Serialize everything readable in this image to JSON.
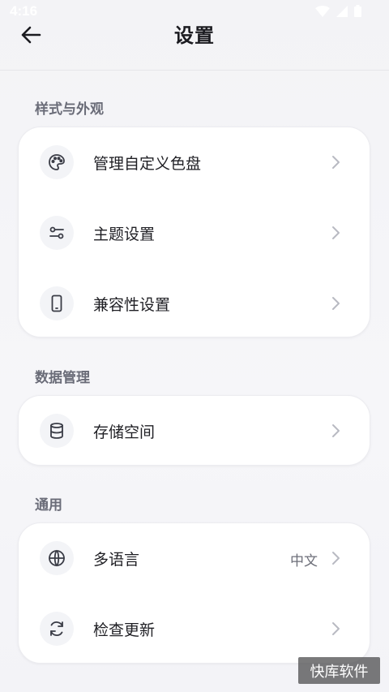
{
  "status_bar": {
    "time": "4:16",
    "icons": [
      "wifi-icon",
      "signal-icon",
      "battery-icon"
    ]
  },
  "app_bar": {
    "title": "设置",
    "back_icon": "arrow-left-icon"
  },
  "sections": [
    {
      "title": "样式与外观",
      "items": [
        {
          "label": "管理自定义色盘",
          "icon": "palette-icon"
        },
        {
          "label": "主题设置",
          "icon": "sliders-icon"
        },
        {
          "label": "兼容性设置",
          "icon": "phone-icon"
        }
      ]
    },
    {
      "title": "数据管理",
      "items": [
        {
          "label": "存储空间",
          "icon": "database-icon"
        }
      ]
    },
    {
      "title": "通用",
      "items": [
        {
          "label": "多语言",
          "icon": "globe-icon",
          "value": "中文"
        },
        {
          "label": "检查更新",
          "icon": "refresh-icon"
        }
      ]
    }
  ],
  "watermark": "快库软件",
  "colors": {
    "background": "#f4f4f7",
    "card": "#ffffff",
    "section_title": "#6a6c78",
    "icon_circle": "#f3f4f7",
    "chevron": "#b8bac2"
  }
}
